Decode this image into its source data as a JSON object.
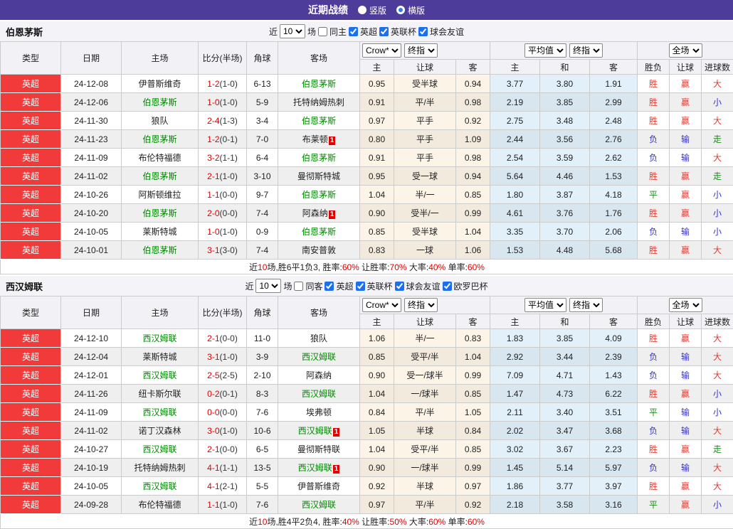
{
  "title_bar": {
    "title": "近期战绩",
    "radio_vertical": "竖版",
    "radio_horizontal": "横版",
    "selected": "横版"
  },
  "colors": {
    "titlebar_purple": "#4e3c9b",
    "type_red": "#f13a3a",
    "team_green": "#008800",
    "score_red": "#e00000",
    "result_red": "#e03c32",
    "result_blue": "#3333cc",
    "result_green": "#1e8a1e"
  },
  "result_color_map": {
    "胜": "#e03c32",
    "赢": "#e03c32",
    "大": "#e03c32",
    "负": "#3333cc",
    "输": "#3333cc",
    "小": "#3333cc",
    "平": "#1e8a1e",
    "走": "#1e8a1e"
  },
  "table_header": {
    "main": [
      "类型",
      "日期",
      "主场",
      "比分(半场)",
      "角球",
      "客场"
    ],
    "sub": [
      "主",
      "让球",
      "客",
      "主",
      "和",
      "客",
      "胜负",
      "让球",
      "进球数"
    ],
    "controls": {
      "bookmaker": "Crow*",
      "bookmaker_type": "终指",
      "average": "平均值",
      "average_type": "终指",
      "scope": "全场"
    }
  },
  "sections": [
    {
      "team": "伯恩茅斯",
      "filter": {
        "near": "近",
        "count": "10",
        "unit": "场",
        "same": {
          "label": "同主",
          "checked": false
        },
        "leagues": [
          {
            "label": "英超",
            "checked": true
          },
          {
            "label": "英联杯",
            "checked": true
          },
          {
            "label": "球会友谊",
            "checked": true
          }
        ]
      },
      "rows": [
        {
          "type": "英超",
          "date": "24-12-08",
          "home": "伊普斯维奇",
          "away": "伯恩茅斯",
          "score": "1-2",
          "half": "(1-0)",
          "corners": "6-13",
          "crow": [
            "0.95",
            "受半球",
            "0.94"
          ],
          "avg": [
            "3.77",
            "3.80",
            "1.91"
          ],
          "result": [
            "胜",
            "赢",
            "大"
          ]
        },
        {
          "type": "英超",
          "date": "24-12-06",
          "home": "伯恩茅斯",
          "away": "托特纳姆热刺",
          "score": "1-0",
          "half": "(1-0)",
          "corners": "5-9",
          "crow": [
            "0.91",
            "平/半",
            "0.98"
          ],
          "avg": [
            "2.19",
            "3.85",
            "2.99"
          ],
          "result": [
            "胜",
            "赢",
            "小"
          ]
        },
        {
          "type": "英超",
          "date": "24-11-30",
          "home": "狼队",
          "away": "伯恩茅斯",
          "score": "2-4",
          "half": "(1-3)",
          "corners": "3-4",
          "crow": [
            "0.97",
            "平手",
            "0.92"
          ],
          "avg": [
            "2.75",
            "3.48",
            "2.48"
          ],
          "result": [
            "胜",
            "赢",
            "大"
          ]
        },
        {
          "type": "英超",
          "date": "24-11-23",
          "home": "伯恩茅斯",
          "away": "布莱顿",
          "away_badge": "1",
          "score": "1-2",
          "half": "(0-1)",
          "corners": "7-0",
          "crow": [
            "0.80",
            "平手",
            "1.09"
          ],
          "avg": [
            "2.44",
            "3.56",
            "2.76"
          ],
          "result": [
            "负",
            "输",
            "走"
          ]
        },
        {
          "type": "英超",
          "date": "24-11-09",
          "home": "布伦特福德",
          "away": "伯恩茅斯",
          "score": "3-2",
          "half": "(1-1)",
          "corners": "6-4",
          "crow": [
            "0.91",
            "平手",
            "0.98"
          ],
          "avg": [
            "2.54",
            "3.59",
            "2.62"
          ],
          "result": [
            "负",
            "输",
            "大"
          ]
        },
        {
          "type": "英超",
          "date": "24-11-02",
          "home": "伯恩茅斯",
          "away": "曼彻斯特城",
          "score": "2-1",
          "half": "(1-0)",
          "corners": "3-10",
          "crow": [
            "0.95",
            "受一球",
            "0.94"
          ],
          "avg": [
            "5.64",
            "4.46",
            "1.53"
          ],
          "result": [
            "胜",
            "赢",
            "走"
          ]
        },
        {
          "type": "英超",
          "date": "24-10-26",
          "home": "阿斯顿维拉",
          "away": "伯恩茅斯",
          "score": "1-1",
          "half": "(0-0)",
          "corners": "9-7",
          "crow": [
            "1.04",
            "半/一",
            "0.85"
          ],
          "avg": [
            "1.80",
            "3.87",
            "4.18"
          ],
          "result": [
            "平",
            "赢",
            "小"
          ]
        },
        {
          "type": "英超",
          "date": "24-10-20",
          "home": "伯恩茅斯",
          "away": "阿森纳",
          "away_badge": "1",
          "score": "2-0",
          "half": "(0-0)",
          "corners": "7-4",
          "crow": [
            "0.90",
            "受半/一",
            "0.99"
          ],
          "avg": [
            "4.61",
            "3.76",
            "1.76"
          ],
          "result": [
            "胜",
            "赢",
            "小"
          ]
        },
        {
          "type": "英超",
          "date": "24-10-05",
          "home": "莱斯特城",
          "away": "伯恩茅斯",
          "score": "1-0",
          "half": "(1-0)",
          "corners": "0-9",
          "crow": [
            "0.85",
            "受半球",
            "1.04"
          ],
          "avg": [
            "3.35",
            "3.70",
            "2.06"
          ],
          "result": [
            "负",
            "输",
            "小"
          ]
        },
        {
          "type": "英超",
          "date": "24-10-01",
          "home": "伯恩茅斯",
          "away": "南安普敦",
          "score": "3-1",
          "half": "(3-0)",
          "corners": "7-4",
          "crow": [
            "0.83",
            "一球",
            "1.06"
          ],
          "avg": [
            "1.53",
            "4.48",
            "5.68"
          ],
          "result": [
            "胜",
            "赢",
            "大"
          ]
        }
      ],
      "summary_parts": [
        {
          "text": "近",
          "red": false
        },
        {
          "text": "10",
          "red": true
        },
        {
          "text": "场,胜6平1负3, 胜率:",
          "red": false
        },
        {
          "text": "60%",
          "red": true
        },
        {
          "text": " 让胜率:",
          "red": false
        },
        {
          "text": "70%",
          "red": true
        },
        {
          "text": " 大率:",
          "red": false
        },
        {
          "text": "40%",
          "red": true
        },
        {
          "text": " 单率:",
          "red": false
        },
        {
          "text": "60%",
          "red": true
        }
      ]
    },
    {
      "team": "西汉姆联",
      "filter": {
        "near": "近",
        "count": "10",
        "unit": "场",
        "same": {
          "label": "同客",
          "checked": false
        },
        "leagues": [
          {
            "label": "英超",
            "checked": true
          },
          {
            "label": "英联杯",
            "checked": true
          },
          {
            "label": "球会友谊",
            "checked": true
          },
          {
            "label": "欧罗巴杯",
            "checked": true
          }
        ]
      },
      "rows": [
        {
          "type": "英超",
          "date": "24-12-10",
          "home": "西汉姆联",
          "away": "狼队",
          "score": "2-1",
          "half": "(0-0)",
          "corners": "11-0",
          "crow": [
            "1.06",
            "半/一",
            "0.83"
          ],
          "avg": [
            "1.83",
            "3.85",
            "4.09"
          ],
          "result": [
            "胜",
            "赢",
            "大"
          ]
        },
        {
          "type": "英超",
          "date": "24-12-04",
          "home": "莱斯特城",
          "away": "西汉姆联",
          "score": "3-1",
          "half": "(1-0)",
          "corners": "3-9",
          "crow": [
            "0.85",
            "受平/半",
            "1.04"
          ],
          "avg": [
            "2.92",
            "3.44",
            "2.39"
          ],
          "result": [
            "负",
            "输",
            "大"
          ]
        },
        {
          "type": "英超",
          "date": "24-12-01",
          "home": "西汉姆联",
          "away": "阿森纳",
          "score": "2-5",
          "half": "(2-5)",
          "corners": "2-10",
          "crow": [
            "0.90",
            "受一/球半",
            "0.99"
          ],
          "avg": [
            "7.09",
            "4.71",
            "1.43"
          ],
          "result": [
            "负",
            "输",
            "大"
          ]
        },
        {
          "type": "英超",
          "date": "24-11-26",
          "home": "纽卡斯尔联",
          "away": "西汉姆联",
          "score": "0-2",
          "half": "(0-1)",
          "corners": "8-3",
          "crow": [
            "1.04",
            "一/球半",
            "0.85"
          ],
          "avg": [
            "1.47",
            "4.73",
            "6.22"
          ],
          "result": [
            "胜",
            "赢",
            "小"
          ]
        },
        {
          "type": "英超",
          "date": "24-11-09",
          "home": "西汉姆联",
          "away": "埃弗顿",
          "score": "0-0",
          "half": "(0-0)",
          "corners": "7-6",
          "crow": [
            "0.84",
            "平/半",
            "1.05"
          ],
          "avg": [
            "2.11",
            "3.40",
            "3.51"
          ],
          "result": [
            "平",
            "输",
            "小"
          ]
        },
        {
          "type": "英超",
          "date": "24-11-02",
          "home": "诺丁汉森林",
          "away": "西汉姆联",
          "away_badge": "1",
          "score": "3-0",
          "half": "(1-0)",
          "corners": "10-6",
          "crow": [
            "1.05",
            "半球",
            "0.84"
          ],
          "avg": [
            "2.02",
            "3.47",
            "3.68"
          ],
          "result": [
            "负",
            "输",
            "大"
          ]
        },
        {
          "type": "英超",
          "date": "24-10-27",
          "home": "西汉姆联",
          "away": "曼彻斯特联",
          "score": "2-1",
          "half": "(0-0)",
          "corners": "6-5",
          "crow": [
            "1.04",
            "受平/半",
            "0.85"
          ],
          "avg": [
            "3.02",
            "3.67",
            "2.23"
          ],
          "result": [
            "胜",
            "赢",
            "走"
          ]
        },
        {
          "type": "英超",
          "date": "24-10-19",
          "home": "托特纳姆热刺",
          "away": "西汉姆联",
          "away_badge": "1",
          "score": "4-1",
          "half": "(1-1)",
          "corners": "13-5",
          "crow": [
            "0.90",
            "一/球半",
            "0.99"
          ],
          "avg": [
            "1.45",
            "5.14",
            "5.97"
          ],
          "result": [
            "负",
            "输",
            "大"
          ]
        },
        {
          "type": "英超",
          "date": "24-10-05",
          "home": "西汉姆联",
          "away": "伊普斯维奇",
          "score": "4-1",
          "half": "(2-1)",
          "corners": "5-5",
          "crow": [
            "0.92",
            "半球",
            "0.97"
          ],
          "avg": [
            "1.86",
            "3.77",
            "3.97"
          ],
          "result": [
            "胜",
            "赢",
            "大"
          ]
        },
        {
          "type": "英超",
          "date": "24-09-28",
          "home": "布伦特福德",
          "away": "西汉姆联",
          "score": "1-1",
          "half": "(1-0)",
          "corners": "7-6",
          "crow": [
            "0.97",
            "平/半",
            "0.92"
          ],
          "avg": [
            "2.18",
            "3.58",
            "3.16"
          ],
          "result": [
            "平",
            "赢",
            "小"
          ]
        }
      ],
      "summary_parts": [
        {
          "text": "近",
          "red": false
        },
        {
          "text": "10",
          "red": true
        },
        {
          "text": "场,胜4平2负4, 胜率:",
          "red": false
        },
        {
          "text": "40%",
          "red": true
        },
        {
          "text": " 让胜率:",
          "red": false
        },
        {
          "text": "50%",
          "red": true
        },
        {
          "text": " 大率:",
          "red": false
        },
        {
          "text": "60%",
          "red": true
        },
        {
          "text": " 单率:",
          "red": false
        },
        {
          "text": "60%",
          "red": true
        }
      ]
    }
  ]
}
